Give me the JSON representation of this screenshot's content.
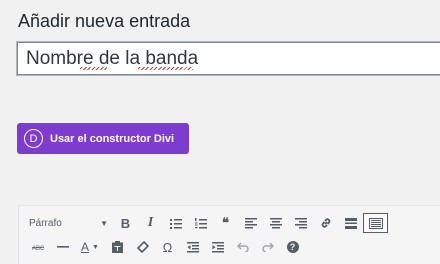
{
  "page": {
    "title": "Añadir nueva entrada"
  },
  "title_field": {
    "value": "Nombre de la banda"
  },
  "divi": {
    "logo_letter": "D",
    "label": "Usar el constructor Divi",
    "color": "#7e3bd0"
  },
  "editor": {
    "format_select": {
      "value": "Párrafo"
    },
    "row1_icons": [
      "bold-icon",
      "italic-icon",
      "bullet-list-icon",
      "numbered-list-icon",
      "blockquote-icon",
      "align-left-icon",
      "align-center-icon",
      "align-right-icon",
      "link-icon",
      "read-more-icon",
      "toolbar-toggle-icon"
    ],
    "row2_icons": [
      "strikethrough-icon",
      "horizontal-line-icon",
      "text-color-icon",
      "paste-as-text-icon",
      "clear-formatting-icon",
      "special-character-icon",
      "outdent-icon",
      "indent-icon",
      "undo-icon",
      "redo-icon",
      "help-icon"
    ],
    "labels": {
      "bold": "B",
      "italic": "I",
      "blockquote": "❝",
      "text_color": "A",
      "omega": "Ω",
      "help": "?"
    }
  }
}
